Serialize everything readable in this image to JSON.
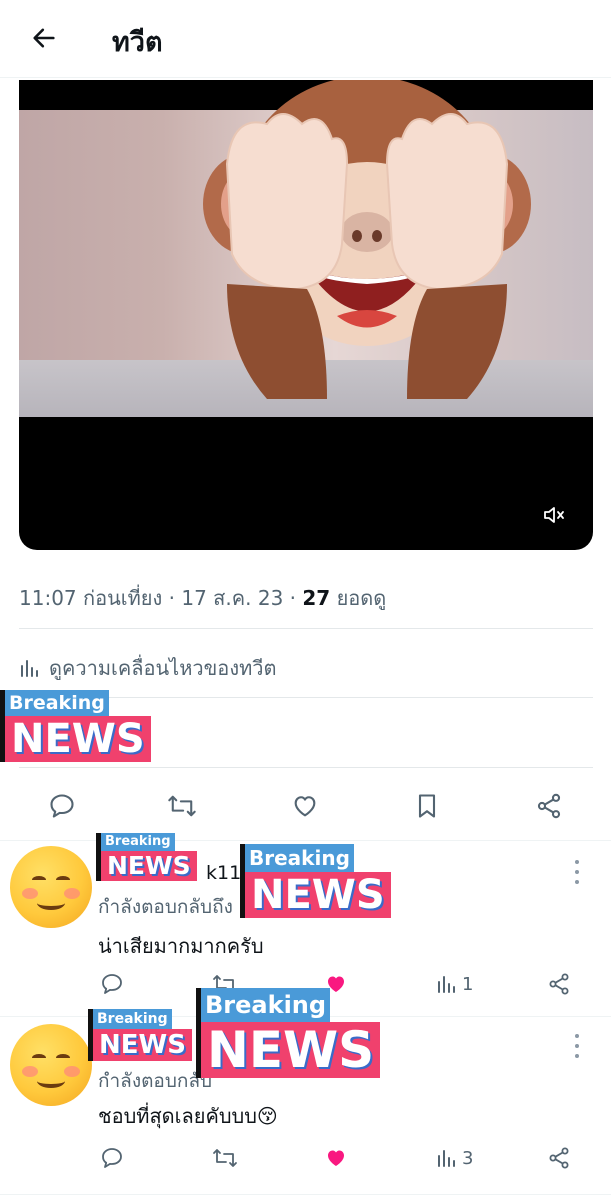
{
  "header": {
    "title": "ทวีต",
    "back_icon": "arrow-left-icon"
  },
  "tweet": {
    "time": "11:07 ก่อนเที่ยง",
    "date": "17 ส.ค. 23",
    "views_count": "27",
    "views_label": "ยอดดู",
    "analytics_label": "ดูความเคลื่อนไหวของทวีต",
    "media": {
      "description_icon": "see-no-evil-monkey-icon",
      "mute_icon": "speaker-muted-icon"
    }
  },
  "stickers": {
    "breaking": "Breaking",
    "news": "NEWS"
  },
  "actions": [
    "reply-icon",
    "retweet-icon",
    "like-icon",
    "bookmark-icon",
    "share-icon"
  ],
  "replies": [
    {
      "handle_fragment": "k11",
      "reply_to": "กำลังตอบกลับถึง",
      "text": "น่าเสียมากมากครับ",
      "views": "1",
      "liked": true
    },
    {
      "handle_fragment": "",
      "reply_to": "กำลังตอบกลับ",
      "text": "ชอบที่สุดเลยคับบบ😚",
      "views": "3",
      "liked": true
    }
  ],
  "colors": {
    "like": "#f91880",
    "muted": "#536471",
    "accent_blue": "#4a9ad8",
    "accent_pink": "#f0416d"
  }
}
